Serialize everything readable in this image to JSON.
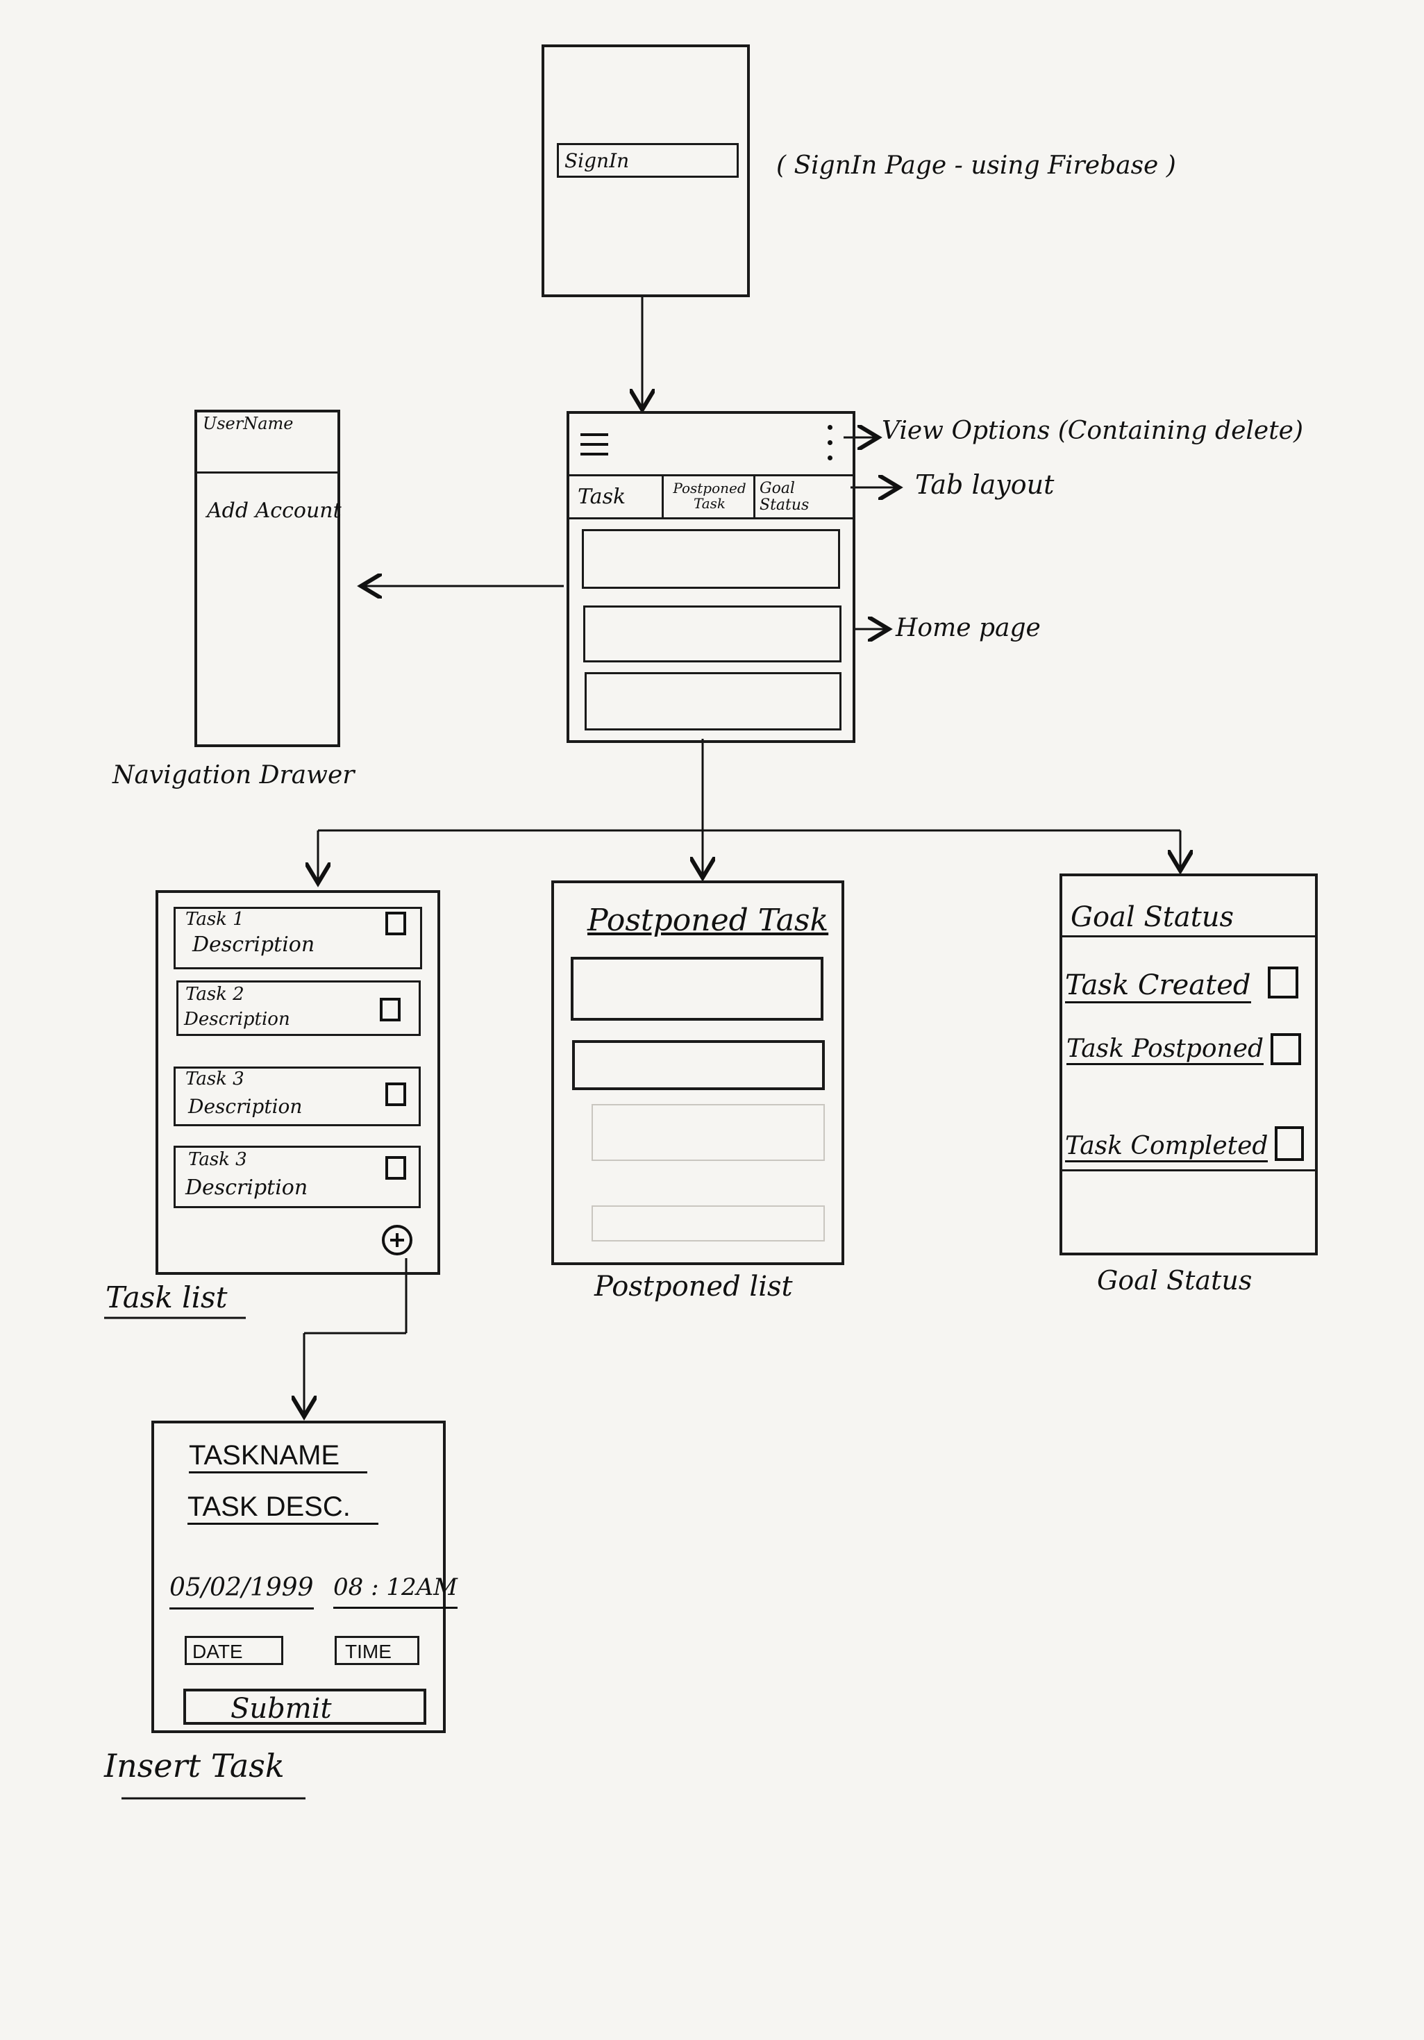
{
  "signin": {
    "button": "SignIn",
    "note": "( SignIn Page - using Firebase )"
  },
  "drawer": {
    "username": "UserName",
    "add_account": "Add Account",
    "caption": "Navigation Drawer"
  },
  "home": {
    "tabs": [
      "Task",
      "Postponed Task",
      "Goal Status"
    ],
    "note_view_options": "View Options (Containing delete)",
    "note_tab_layout": "Tab layout",
    "note_home_page": "Home page"
  },
  "tasklist": {
    "items": [
      {
        "title": "Task 1",
        "desc": "Description"
      },
      {
        "title": "Task 2",
        "desc": "Description"
      },
      {
        "title": "Task 3",
        "desc": "Description"
      },
      {
        "title": "Task 3",
        "desc": "Description"
      }
    ],
    "caption": "Task list"
  },
  "postponed": {
    "title": "Postponed Task",
    "caption": "Postponed list"
  },
  "goal": {
    "title": "Goal Status",
    "items": [
      "Task Created",
      "Task Postponed",
      "Task Completed"
    ],
    "caption": "Goal Status"
  },
  "insert": {
    "task_name": "TASKNAME",
    "task_desc": "TASK DESC.",
    "date_value": "05/02/1999",
    "time_value": "08 : 12AM",
    "date_button": "DATE",
    "time_button": "TIME",
    "submit": "Submit",
    "caption": "Insert Task"
  }
}
